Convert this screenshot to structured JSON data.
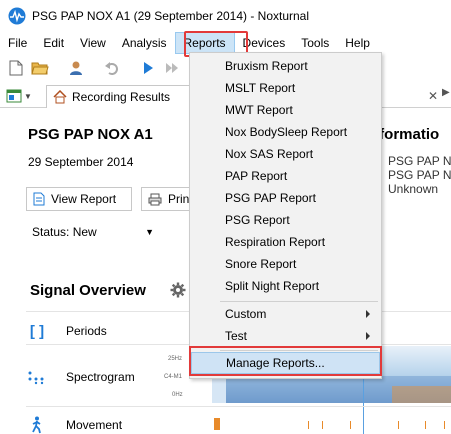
{
  "window": {
    "title": "PSG PAP NOX A1 (29 September 2014)  - Noxturnal",
    "app_icon": "noxturnal-logo-icon",
    "accent_color": "#1f7bd6"
  },
  "menubar": {
    "items": [
      "File",
      "Edit",
      "View",
      "Analysis",
      "Reports",
      "Devices",
      "Tools",
      "Help"
    ],
    "active": "Reports",
    "highlight_color": "#e23a3a"
  },
  "toolbar": {
    "icons": [
      "new-document-icon",
      "open-folder-icon",
      "user-icon",
      "undo-icon",
      "play-icon",
      "fast-forward-icon"
    ]
  },
  "tabs": {
    "items": [
      {
        "label": "Recording Results",
        "icon": "home-icon"
      }
    ]
  },
  "recording": {
    "title": "PSG PAP NOX A1",
    "date": "29 September 2014",
    "view_report_label": "View Report",
    "print_label": "Print",
    "status_label": "Status: New"
  },
  "info_panel": {
    "heading": "nformatio",
    "lines": [
      "PSG PAP NO",
      "PSG PAP NO",
      "Unknown"
    ]
  },
  "signal_overview": {
    "title": "Signal Overview",
    "rows": [
      {
        "label": "Periods",
        "icon": "bracket-icon"
      },
      {
        "label": "Spectrogram",
        "icon": "dots-icon"
      },
      {
        "label": "Movement",
        "icon": "walking-person-icon"
      }
    ],
    "spectrogram_ticks": [
      "25Hz",
      "C4-M1",
      "0Hz"
    ]
  },
  "reports_menu": {
    "items": [
      "Bruxism Report",
      "MSLT Report",
      "MWT Report",
      "Nox BodySleep Report",
      "Nox SAS Report",
      "PAP Report",
      "PSG PAP Report",
      "PSG Report",
      "Respiration Report",
      "Snore Report",
      "Split Night Report"
    ],
    "submenus": [
      "Custom",
      "Test"
    ],
    "manage_label": "Manage Reports...",
    "hover_color": "#cfe3f5"
  }
}
